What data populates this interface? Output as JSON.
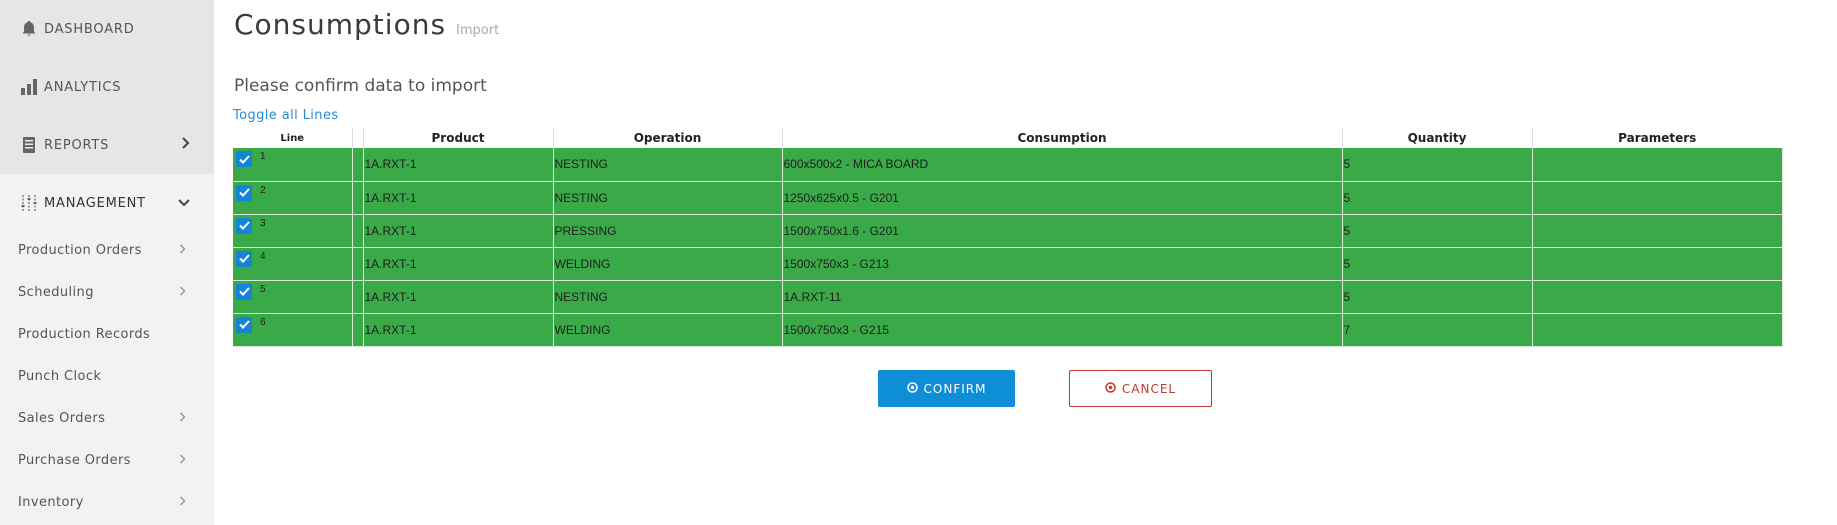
{
  "sidebar": {
    "top": [
      {
        "label": "DASHBOARD",
        "icon": "bell-icon"
      },
      {
        "label": "ANALYTICS",
        "icon": "bar-chart-icon"
      },
      {
        "label": "REPORTS",
        "icon": "document-icon"
      },
      {
        "label": "MANAGEMENT",
        "icon": "sliders-icon"
      }
    ],
    "items": [
      {
        "label": "Production Orders",
        "has_children": true
      },
      {
        "label": "Scheduling",
        "has_children": true
      },
      {
        "label": "Production Records",
        "has_children": false
      },
      {
        "label": "Punch Clock",
        "has_children": false
      },
      {
        "label": "Sales Orders",
        "has_children": true
      },
      {
        "label": "Purchase Orders",
        "has_children": true
      },
      {
        "label": "Inventory",
        "has_children": true
      }
    ]
  },
  "page": {
    "title": "Consumptions",
    "subtitle": "Import",
    "heading": "Please confirm data to import",
    "toggle_label": "Toggle all Lines"
  },
  "table": {
    "columns": [
      "Line",
      "",
      "Product",
      "Operation",
      "Consumption",
      "Quantity",
      "Parameters"
    ],
    "rows": [
      {
        "line": "1",
        "checked": true,
        "product": "1A.RXT-1",
        "operation": "NESTING",
        "consumption": "600x500x2 - MICA BOARD",
        "quantity": "5",
        "parameters": ""
      },
      {
        "line": "2",
        "checked": true,
        "product": "1A.RXT-1",
        "operation": "NESTING",
        "consumption": "1250x625x0.5 - G201",
        "quantity": "5",
        "parameters": ""
      },
      {
        "line": "3",
        "checked": true,
        "product": "1A.RXT-1",
        "operation": "PRESSING",
        "consumption": "1500x750x1.6 - G201",
        "quantity": "5",
        "parameters": ""
      },
      {
        "line": "4",
        "checked": true,
        "product": "1A.RXT-1",
        "operation": "WELDING",
        "consumption": "1500x750x3 - G213",
        "quantity": "5",
        "parameters": ""
      },
      {
        "line": "5",
        "checked": true,
        "product": "1A.RXT-1",
        "operation": "NESTING",
        "consumption": "1A.RXT-11",
        "quantity": "5",
        "parameters": ""
      },
      {
        "line": "6",
        "checked": true,
        "product": "1A.RXT-1",
        "operation": "WELDING",
        "consumption": "1500x750x3 - G215",
        "quantity": "7",
        "parameters": ""
      }
    ]
  },
  "buttons": {
    "confirm": "CONFIRM",
    "cancel": "CANCEL"
  },
  "colors": {
    "row_success": "#3aaa48",
    "primary": "#0f8ed8",
    "danger": "#c0392b",
    "link": "#2a8ad0"
  }
}
